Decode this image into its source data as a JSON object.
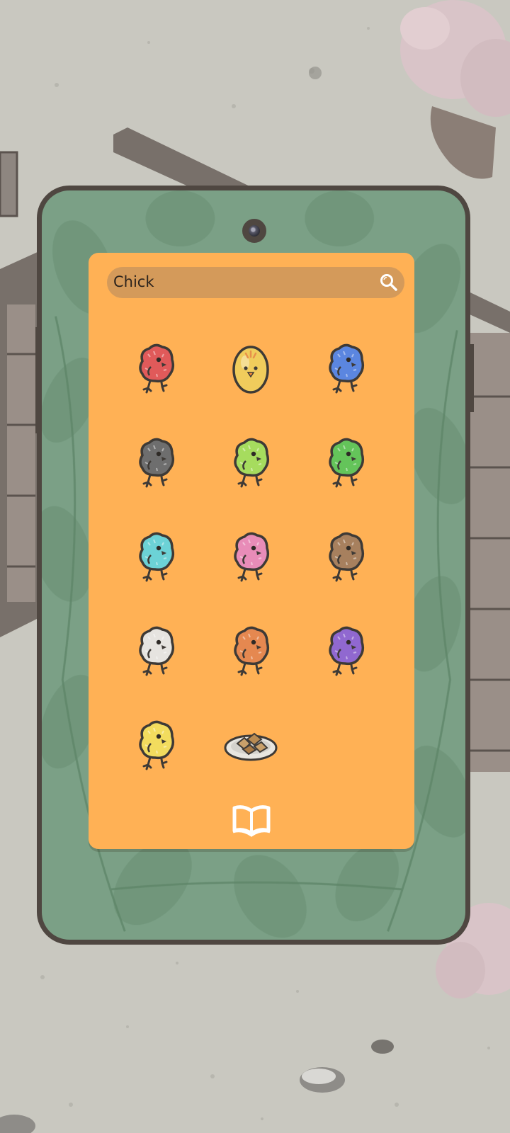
{
  "search": {
    "value": "Chick"
  },
  "icons": {
    "search": "magnifier-icon",
    "book": "book-icon"
  },
  "items": [
    {
      "kind": "chick",
      "color": "#e05a5a"
    },
    {
      "kind": "egg",
      "color": "#f0cc5c"
    },
    {
      "kind": "chick",
      "color": "#5b86e0"
    },
    {
      "kind": "chick",
      "color": "#6e6e6e"
    },
    {
      "kind": "chick",
      "color": "#a6dc5e"
    },
    {
      "kind": "chick",
      "color": "#64c45a"
    },
    {
      "kind": "chick",
      "color": "#6cd2d6"
    },
    {
      "kind": "chick",
      "color": "#e88cb8"
    },
    {
      "kind": "chick",
      "color": "#a7805e"
    },
    {
      "kind": "chick",
      "color": "#e6e4e0"
    },
    {
      "kind": "chick",
      "color": "#e58850"
    },
    {
      "kind": "chick",
      "color": "#9068d0"
    },
    {
      "kind": "chick",
      "color": "#f2dc5e"
    },
    {
      "kind": "plate",
      "color": "#c9a06a"
    }
  ],
  "colors": {
    "panel": "#ffb155",
    "search_bar": "#d49a5a",
    "phone_case": "#7ba086",
    "phone_border": "#4f4741"
  }
}
